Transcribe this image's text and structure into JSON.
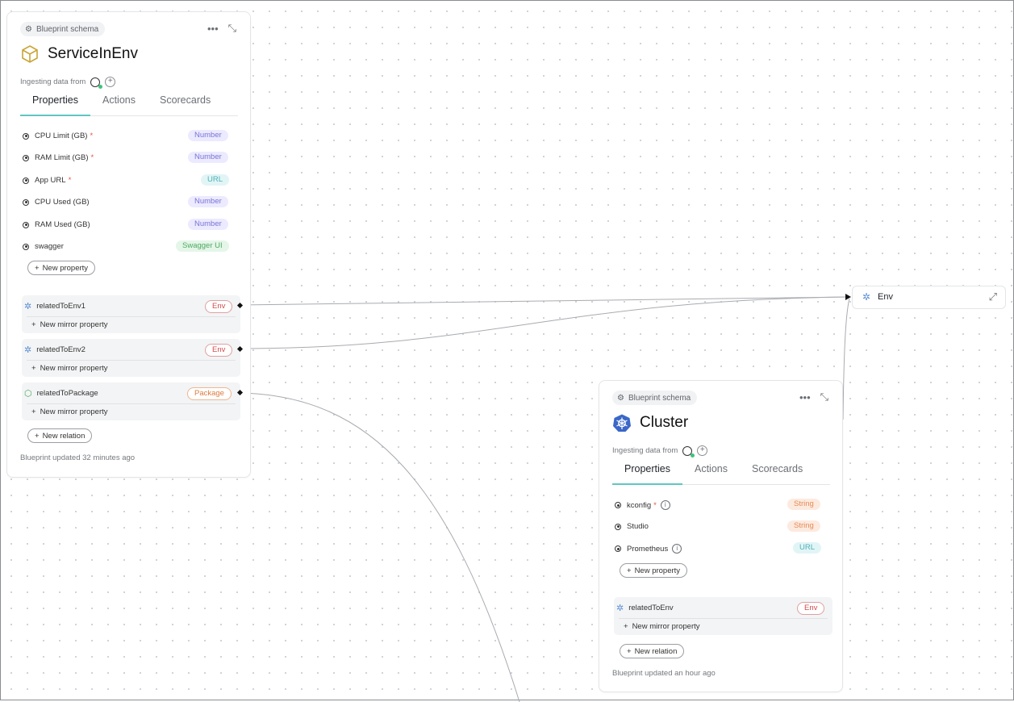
{
  "canvas": {},
  "service_card": {
    "schema_chip": "Blueprint schema",
    "title": "ServiceInEnv",
    "ingesting_label": "Ingesting data from",
    "tabs": [
      "Properties",
      "Actions",
      "Scorecards"
    ],
    "properties": [
      {
        "name": "CPU Limit (GB)",
        "required": "*",
        "type": "Number"
      },
      {
        "name": "RAM Limit (GB)",
        "required": "*",
        "type": "Number"
      },
      {
        "name": "App URL",
        "required": "*",
        "type": "URL"
      },
      {
        "name": "CPU Used (GB)",
        "required": "",
        "type": "Number"
      },
      {
        "name": "RAM Used (GB)",
        "required": "",
        "type": "Number"
      },
      {
        "name": "swagger",
        "required": "",
        "type": "Swagger UI"
      }
    ],
    "new_property": "New property",
    "relations": [
      {
        "name": "relatedToEnv1",
        "target": "Env",
        "mirror": "New mirror property"
      },
      {
        "name": "relatedToEnv2",
        "target": "Env",
        "mirror": "New mirror property"
      },
      {
        "name": "relatedToPackage",
        "target": "Package",
        "mirror": "New mirror property"
      }
    ],
    "new_relation": "New relation",
    "updated": "Blueprint updated 32 minutes ago"
  },
  "cluster_card": {
    "schema_chip": "Blueprint schema",
    "title": "Cluster",
    "ingesting_label": "Ingesting data from",
    "tabs": [
      "Properties",
      "Actions",
      "Scorecards"
    ],
    "properties": [
      {
        "name": "kconfig",
        "required": "*",
        "type": "String",
        "info": true
      },
      {
        "name": "Studio",
        "required": "",
        "type": "String",
        "info": false
      },
      {
        "name": "Prometheus",
        "required": "",
        "type": "URL",
        "info": true
      }
    ],
    "new_property": "New property",
    "relations": [
      {
        "name": "relatedToEnv",
        "target": "Env",
        "mirror": "New mirror property"
      }
    ],
    "new_relation": "New relation",
    "updated": "Blueprint updated an hour ago"
  },
  "env_node": {
    "title": "Env"
  },
  "colors": {
    "accent_tab": "#5fc7c1",
    "required": "#e4573d",
    "status_online": "#3cc47c"
  }
}
